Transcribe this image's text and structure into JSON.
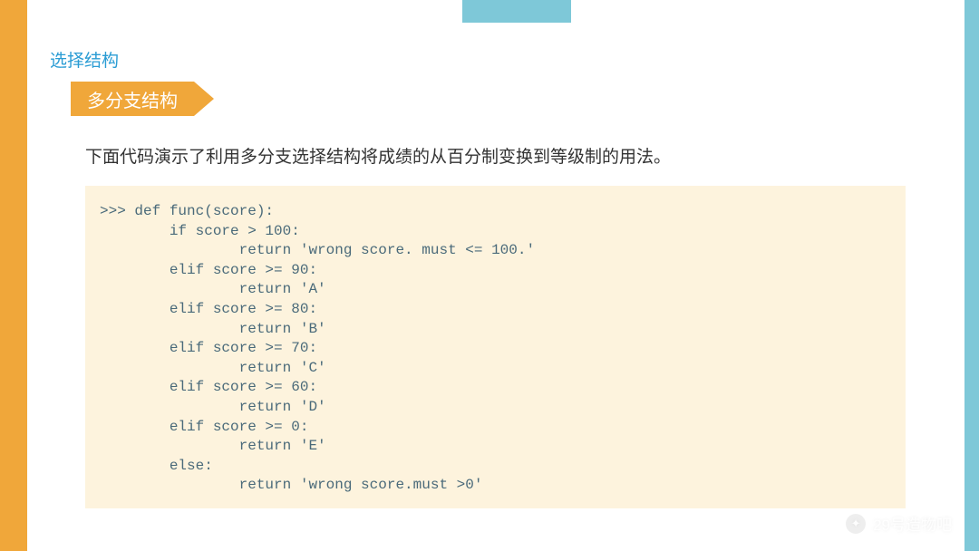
{
  "section_title": "选择结构",
  "banner": "多分支结构",
  "description": "下面代码演示了利用多分支选择结构将成绩的从百分制变换到等级制的用法。",
  "code": ">>> def func(score):\n        if score > 100:\n                return 'wrong score. must <= 100.'\n        elif score >= 90:\n                return 'A'\n        elif score >= 80:\n                return 'B'\n        elif score >= 70:\n                return 'C'\n        elif score >= 60:\n                return 'D'\n        elif score >= 0:\n                return 'E'\n        else:\n                return 'wrong score.must >0'",
  "watermark": "29号造物吧"
}
